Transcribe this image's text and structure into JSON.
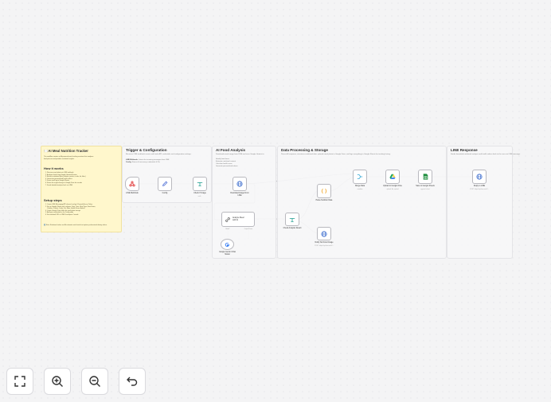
{
  "sticky": {
    "title": "🍽️AI Meal Nutrition Tracker",
    "intro": [
      "This workflow creates an AI-powered meal tracking assistant that analyzes",
      "food pictures and provides nutritional insights."
    ],
    "how_heading": "How it works",
    "how_steps": [
      "Receives meal photo via LINE webhook",
      "Analyzes food using Google Gemini AI vision",
      "Extracts nutritional data (calories, protein, carbs, fat, fiber)",
      "Generates personalized health advice",
      "Saves meal log to Google Sheets",
      "Stores the original image in Google Drive for records",
      "Sends detailed analysis back via LINE"
    ],
    "setup_heading": "Setup steps",
    "setup_steps": [
      "Create LINE Messaging API channel and get Channel Access Token",
      "Set up Google Sheets with columns: Date, Time, Meal Type, Food Items,",
      "Calories, Protein, Carbs, Fat, Fiber, Health Score, Advice",
      "Create Google Drive folder for meal photo storage",
      "Add your credentials in the Config node",
      "Set webhook URL in LINE Developers Console"
    ],
    "note": "ℹ️ Note: Nutritional values are AI estimates and should not replace professional dietary advice."
  },
  "groups": {
    "trigger": {
      "title": "Trigger & Configuration",
      "desc": "Receives LINE webhook events and loads API credentials and configuration settings.",
      "line1_key": "LINE Webhook:",
      "line1_val": "Listens for incoming messages from LINE",
      "line2_key": "Config:",
      "line2_val": "Stores all necessary credentials & IDs"
    },
    "ai": {
      "title": "AI Food Analysis",
      "desc": "Downloads meal image from LINE and uses Google Gemini to:",
      "items": [
        "Identify food items",
        "Estimate nutritional content",
        "Calculate health score",
        "Generate personalized advice"
      ]
    },
    "data": {
      "title": "Data Processing & Storage",
      "desc": "Parses AI response, structures nutritional data, uploads meal photo to Google Drive, and logs everything to Google Sheets for tracking history."
    },
    "line": {
      "title": "LINE Response",
      "desc": "Sends formatted nutritional analysis and health advice back to the user via LINE message."
    }
  },
  "nodes": {
    "line_webhook": {
      "label": "LINE Webhook",
      "icon": "webhook-icon"
    },
    "config": {
      "label": "Config",
      "icon": "pencil-icon"
    },
    "check_if_image": {
      "label": "Check If Image",
      "icon": "if-icon",
      "sub": "is A..."
    },
    "download_image": {
      "label": "Download Image From",
      "label2": "LINE",
      "icon": "globe-icon"
    },
    "analyze_meal": {
      "label": "Analyze Meal",
      "label2": "with AI",
      "icon": "link-icon",
      "port_left": "Model*",
      "port_right": "Output Parser"
    },
    "gemini": {
      "label": "Google Gemini Chat",
      "label2": "Model",
      "icon": "google-icon"
    },
    "check_result": {
      "label": "Check Analysis Result",
      "icon": "if-icon"
    },
    "parse": {
      "label": "Parse Nutrition Data",
      "icon": "code-icon"
    },
    "notify": {
      "label": "Notify Not Food Image",
      "sub": "POST: https://api.line.me/v2...",
      "icon": "globe-icon"
    },
    "merge": {
      "label": "Merge Data",
      "sub": "combine",
      "icon": "merge-icon"
    },
    "upload_drive": {
      "label": "Upload to Google Drive",
      "sub": "upload: file, upload",
      "icon": "drive-icon"
    },
    "save_sheets": {
      "label": "Save to Google Sheets",
      "sub": "append: sheet",
      "icon": "sheets-icon"
    },
    "reply": {
      "label": "Reply to LINE",
      "sub": "POST: https://api.line.me/v2...",
      "icon": "globe-icon"
    }
  },
  "toolbar": [
    {
      "name": "fit-view-button",
      "icon": "expand-icon"
    },
    {
      "name": "zoom-in-button",
      "icon": "zoom-in-icon"
    },
    {
      "name": "zoom-out-button",
      "icon": "zoom-out-icon"
    },
    {
      "name": "undo-button",
      "icon": "undo-icon"
    }
  ],
  "colors": {
    "sticky_bg": "#fff7cc",
    "edge": "#a7a7ad",
    "webhook": "#e34b4b",
    "config": "#4f6fd6",
    "if": "#1f9e8f",
    "http": "#3366cc",
    "code": "#f0a524",
    "merge": "#34a8d5",
    "sheets": "#1e8e3e"
  }
}
